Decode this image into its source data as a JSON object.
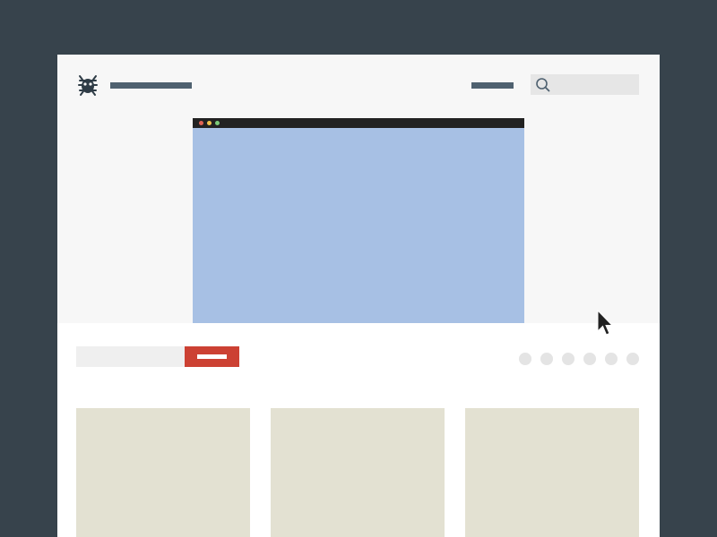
{
  "header": {
    "logo_icon": "bug-icon",
    "search_icon": "search-icon"
  },
  "hero": {
    "browser_mockup": {
      "window_dots": [
        "red",
        "yellow",
        "green"
      ]
    }
  },
  "toolbar": {
    "pager_dot_count": 6
  },
  "cards": [
    {},
    {},
    {}
  ],
  "cursor_icon": "mouse-pointer-icon",
  "colors": {
    "outer_background": "#37434c",
    "hero_background": "#f7f7f7",
    "browser_content": "#a7c0e4",
    "accent_button": "#cc4133",
    "card": "#e3e1d2",
    "placeholder_text": "#4f6170"
  }
}
